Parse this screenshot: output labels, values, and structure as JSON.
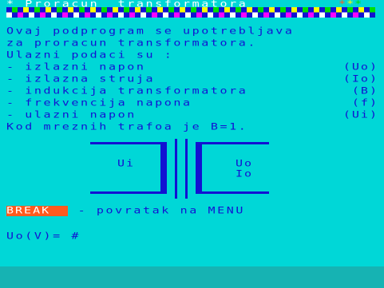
{
  "header": {
    "prefix": "* ",
    "title": "Proracun  transformatora ",
    "stars": [
      "*",
      "*",
      "*"
    ],
    "star_colors": [
      "#ff5a1e",
      "#ffff00",
      "#00e000"
    ]
  },
  "stripe_colors": [
    "#ff00ff",
    "#00e000",
    "#ffffff",
    "#ffff00"
  ],
  "intro": [
    "Ovaj podprogram se upotrebljava",
    "za proracun transformatora.",
    "Ulazni podaci su :"
  ],
  "params": [
    {
      "text": "- izlazni napon",
      "code": "(Uo)"
    },
    {
      "text": "- izlazna struja",
      "code": "(Io)"
    },
    {
      "text": "- indukcija transformatora",
      "code": "(B)"
    },
    {
      "text": "- frekvencija napona",
      "code": "(f)"
    },
    {
      "text": "- ulazni napon",
      "code": "(Ui)"
    }
  ],
  "note": "Kod mreznih trafoa je B=1.",
  "diagram": {
    "ui": "Ui",
    "uo": "Uo",
    "io": "Io"
  },
  "footer": {
    "break_key": "BREAK",
    "break_text": " - povratak na MENU"
  },
  "prompt": {
    "label": "Uo(V)= ",
    "cursor": "#"
  }
}
